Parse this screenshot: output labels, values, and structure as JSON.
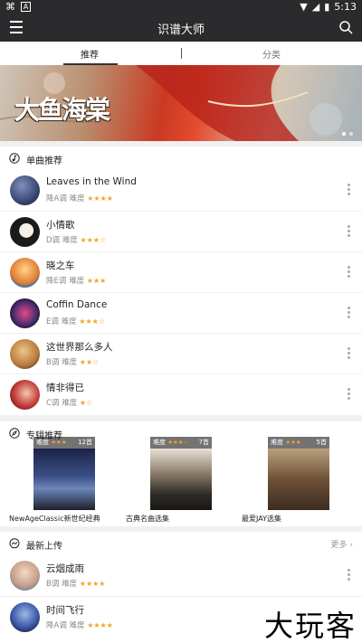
{
  "status_bar": {
    "left_icons": [
      "usb-icon",
      "a-icon"
    ],
    "time": "5:13"
  },
  "app_bar": {
    "title": "识谱大师"
  },
  "tabs": [
    {
      "label": "推荐"
    },
    {
      "label": "分类"
    }
  ],
  "banner": {
    "title": "大鱼海棠",
    "dots": 2,
    "active_dot": 0
  },
  "singles": {
    "header": "单曲推荐",
    "items": [
      {
        "title": "Leaves in the Wind",
        "key": "降A调",
        "difficulty_label": "难度",
        "stars": "★★★★"
      },
      {
        "title": "小情歌",
        "key": "D调",
        "difficulty_label": "难度",
        "stars": "★★★☆"
      },
      {
        "title": "晓之车",
        "key": "降E调",
        "difficulty_label": "难度",
        "stars": "★★★"
      },
      {
        "title": "Coffin Dance",
        "key": "E调",
        "difficulty_label": "难度",
        "stars": "★★★☆"
      },
      {
        "title": "这世界那么多人",
        "key": "B调",
        "difficulty_label": "难度",
        "stars": "★★☆"
      },
      {
        "title": "情非得已",
        "key": "C调",
        "difficulty_label": "难度",
        "stars": "★☆"
      }
    ]
  },
  "albums": {
    "header": "专辑推荐",
    "items": [
      {
        "name": "NewAgeClassic新世纪经典",
        "difficulty_label": "难度",
        "stars": "★★★",
        "count": "12首"
      },
      {
        "name": "古典名曲选集",
        "difficulty_label": "难度",
        "stars": "★★★☆",
        "count": "7首"
      },
      {
        "name": "最爱JAY选集",
        "difficulty_label": "难度",
        "stars": "★★★",
        "count": "5首"
      }
    ]
  },
  "latest": {
    "header": "最新上传",
    "more_label": "更多",
    "items": [
      {
        "title": "云烟成雨",
        "key": "B调",
        "difficulty_label": "难度",
        "stars": "★★★★"
      },
      {
        "title": "时间飞行",
        "key": "降A调",
        "difficulty_label": "难度",
        "stars": "★★★★"
      }
    ]
  },
  "watermark": "大玩客",
  "colors": {
    "app_bar": "#2b2b2e",
    "star": "#f2a42a",
    "background": "#f1f1f1"
  }
}
